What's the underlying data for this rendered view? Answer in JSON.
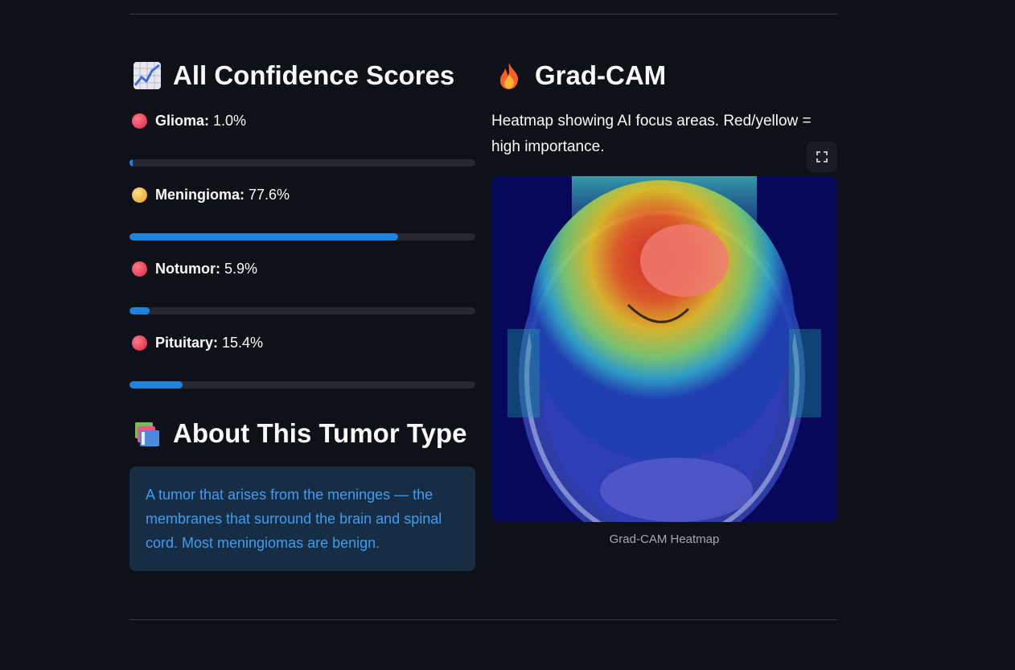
{
  "scores_section": {
    "title": "All Confidence Scores",
    "icon": "chart-increasing-icon",
    "items": [
      {
        "label": "Glioma:",
        "value": "1.0%",
        "percent": 1.0,
        "dot_color": "#e0435a"
      },
      {
        "label": "Meningioma:",
        "value": "77.6%",
        "percent": 77.6,
        "dot_color": "#f0b43c"
      },
      {
        "label": "Notumor:",
        "value": "5.9%",
        "percent": 5.9,
        "dot_color": "#e0435a"
      },
      {
        "label": "Pituitary:",
        "value": "15.4%",
        "percent": 15.4,
        "dot_color": "#e0435a"
      }
    ]
  },
  "about_section": {
    "title": "About This Tumor Type",
    "icon": "books-icon",
    "text": "A tumor that arises from the meninges — the membranes that surround the brain and spinal cord. Most meningiomas are benign."
  },
  "gradcam_section": {
    "title": "Grad-CAM",
    "icon": "fire-icon",
    "description": "Heatmap showing AI focus areas. Red/yellow = high importance.",
    "image_caption": "Grad-CAM Heatmap",
    "fullscreen_icon": "fullscreen-icon"
  },
  "colors": {
    "background": "#0e1117",
    "progress": "#1c83e1",
    "info_bg": "#172d43",
    "info_text": "#3d9df3"
  }
}
